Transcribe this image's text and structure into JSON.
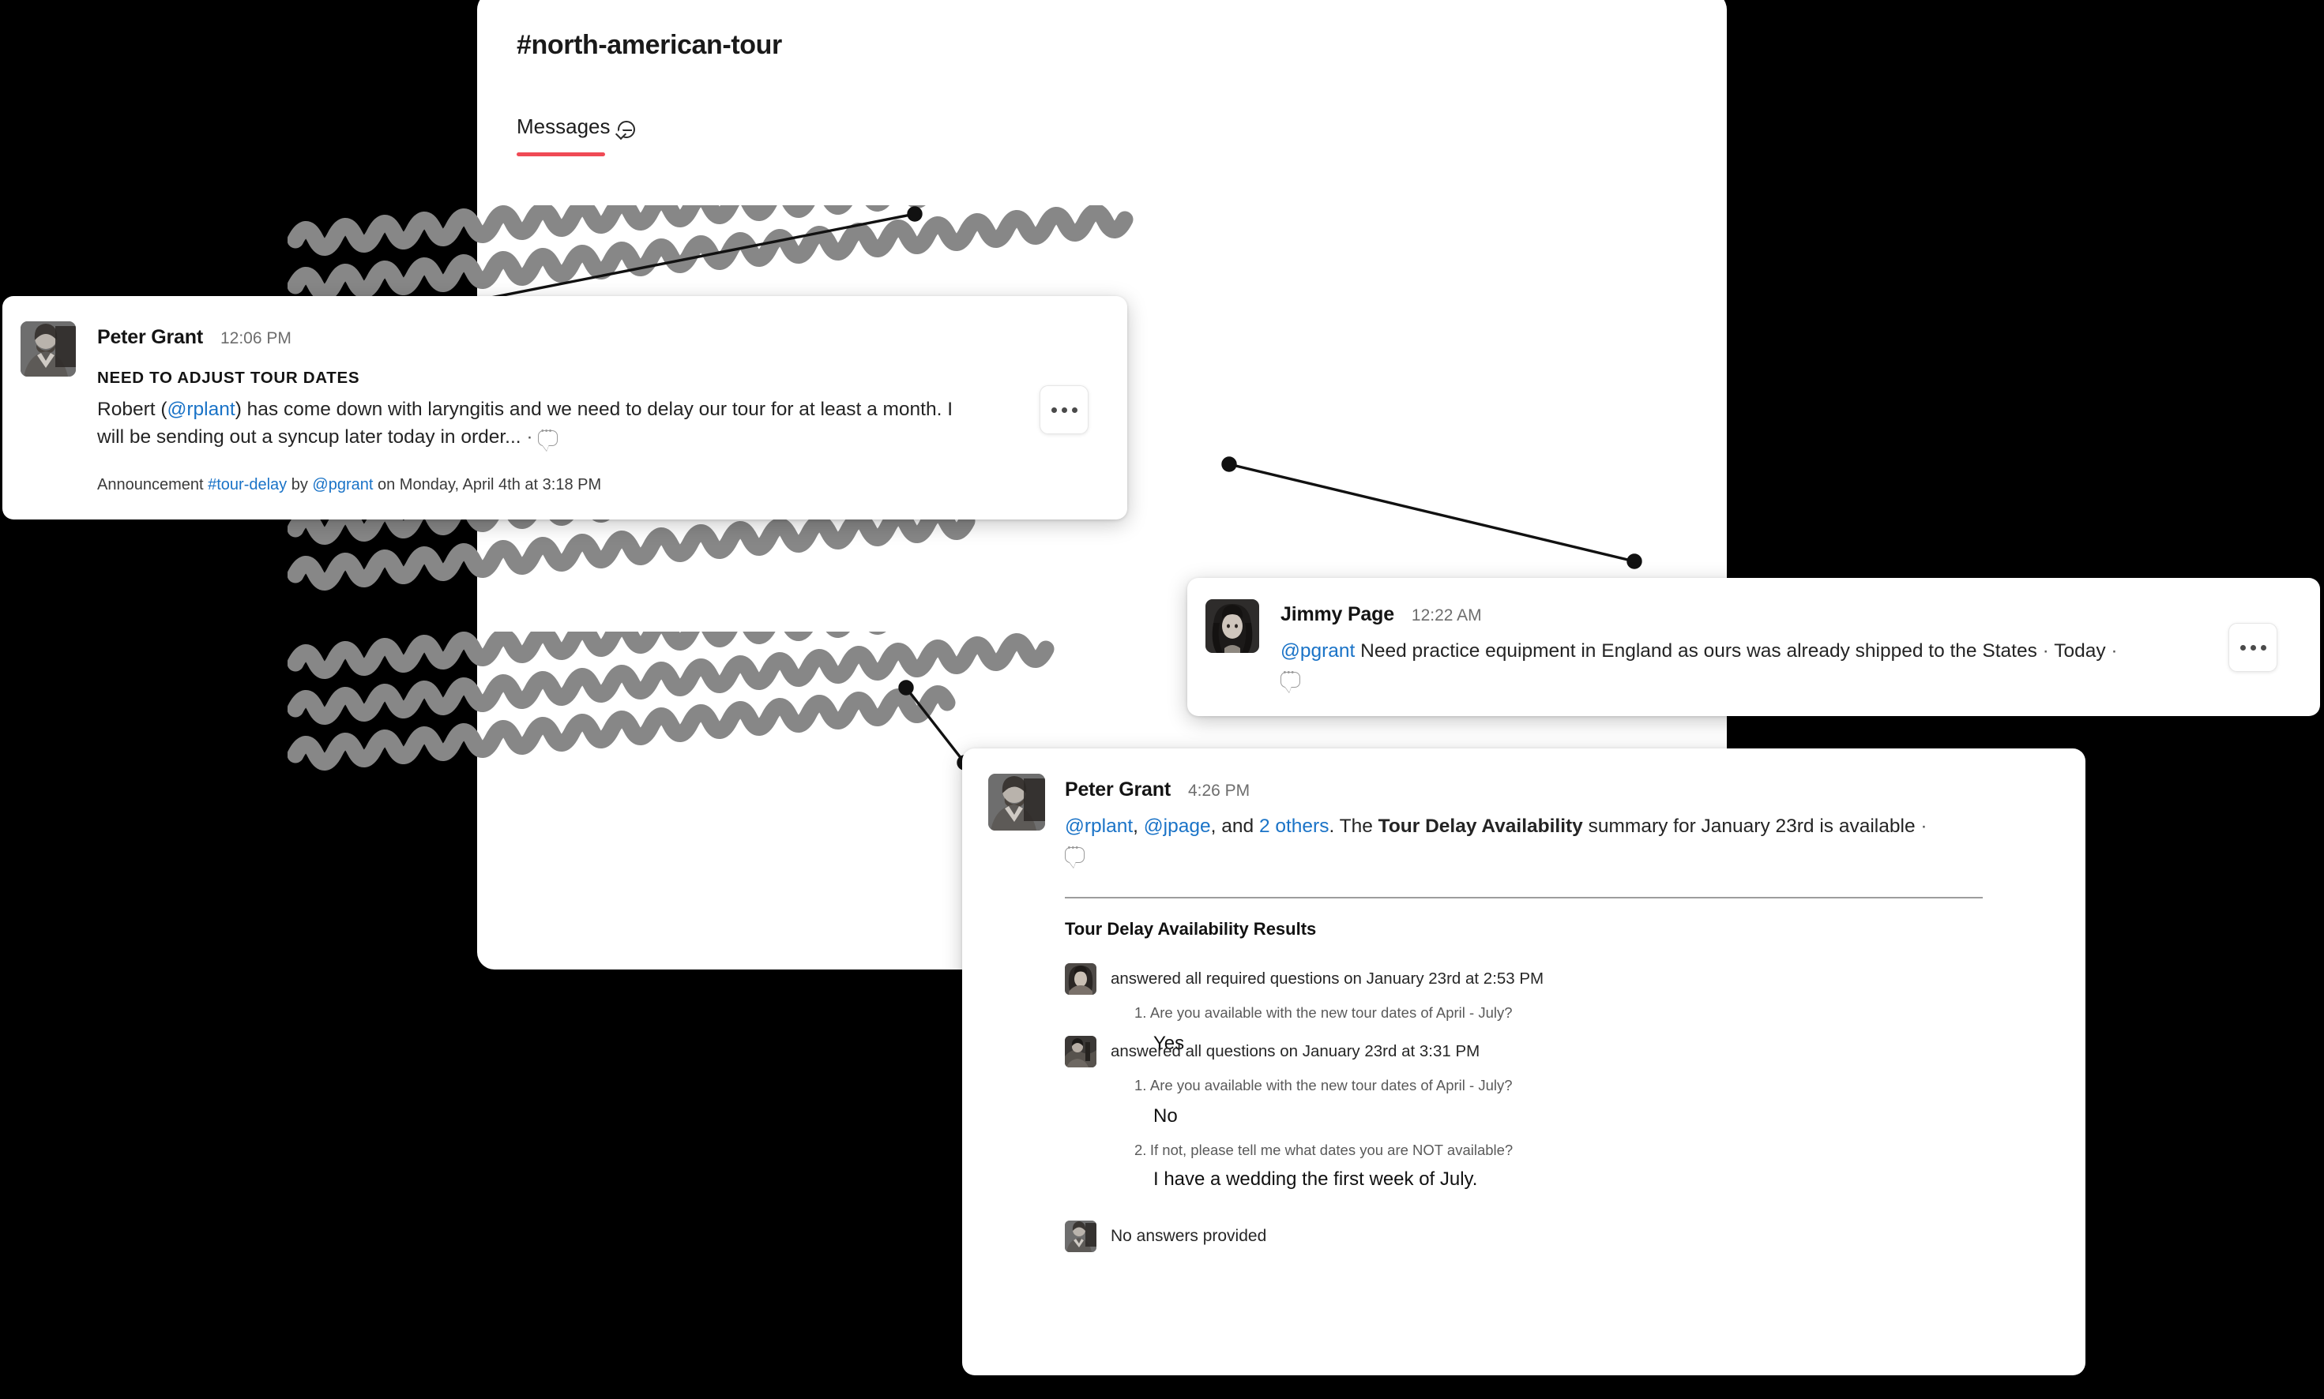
{
  "channel": {
    "title": "#north-american-tour",
    "tab_label": "Messages",
    "tab_icon": "chat-bubble-icon",
    "accent_color": "#f04a55"
  },
  "cards": {
    "announcement": {
      "author": "Peter Grant",
      "time": "12:06 PM",
      "headline": "NEED TO ADJUST TOUR DATES",
      "body_pre": "Robert (",
      "body_mention": "@rplant",
      "body_post": ") has come down with laryngitis and we need to delay our tour for at least a month. I will be sending out a syncup later today in order...",
      "body_sep": "·",
      "meta_prefix": "Announcement",
      "meta_channel": "#tour-delay",
      "meta_by": "by",
      "meta_author": "@pgrant",
      "meta_suffix": "on Monday, April 4th at 3:18 PM",
      "kebab_label": "•••"
    },
    "equipment": {
      "author": "Jimmy Page",
      "time": "12:22 AM",
      "mention": "@pgrant",
      "body": "Need practice equipment in England as ours was already shipped to the States",
      "timestamp_rel": "Today",
      "body_sep": "·",
      "kebab_label": "•••"
    },
    "survey": {
      "author": "Peter Grant",
      "time": "4:26 PM",
      "mention_1": "@rplant",
      "mention_2": "@jpage",
      "mention_and": ", and ",
      "mention_others": "2 others",
      "text_mid": ". The ",
      "survey_name": "Tour Delay Availability",
      "text_tail": " summary for January 23rd is available",
      "body_sep": "·",
      "results_title": "Tour Delay Availability Results",
      "responses": [
        {
          "avatar": "rplant-avatar",
          "header": "answered all required questions on January 23rd at 2:53 PM",
          "items": [
            {
              "num": "1.",
              "question": "Are you available with the new tour dates of April - July?",
              "answer": "Yes"
            }
          ]
        },
        {
          "avatar": "jpage-avatar",
          "header": "answered all questions on January 23rd at 3:31 PM",
          "items": [
            {
              "num": "1.",
              "question": "Are you available with the new tour dates of April - July?",
              "answer": "No"
            },
            {
              "num": "2.",
              "question": "If not, please tell me what dates you are NOT available?",
              "answer": "I have a wedding the first week of July."
            }
          ]
        },
        {
          "avatar": "pgrant-avatar",
          "header": "No answers provided",
          "items": []
        }
      ]
    }
  }
}
